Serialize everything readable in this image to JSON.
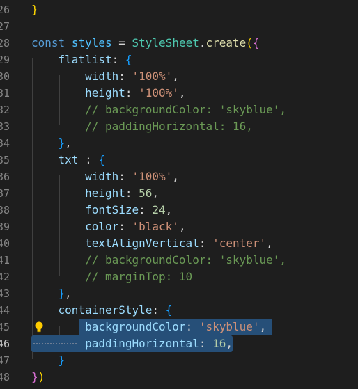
{
  "editor": {
    "line_numbers": [
      "26",
      "27",
      "28",
      "29",
      "30",
      "31",
      "32",
      "33",
      "34",
      "35",
      "36",
      "37",
      "38",
      "39",
      "40",
      "41",
      "42",
      "43",
      "44",
      "45",
      "46",
      "47",
      "48"
    ],
    "active_line": "46",
    "lines": [
      {
        "num": "26",
        "tokens": [
          [
            "b1",
            "}"
          ]
        ]
      },
      {
        "num": "27",
        "tokens": []
      },
      {
        "num": "28",
        "tokens": [
          [
            "kw",
            "const"
          ],
          [
            "p",
            " "
          ],
          [
            "var",
            "styles"
          ],
          [
            "p",
            " = "
          ],
          [
            "cls",
            "StyleSheet"
          ],
          [
            "p",
            "."
          ],
          [
            "fn",
            "create"
          ],
          [
            "b1",
            "("
          ],
          [
            "b2",
            "{"
          ]
        ]
      },
      {
        "num": "29",
        "tokens": [
          [
            "p",
            "    "
          ],
          [
            "prop",
            "flatlist"
          ],
          [
            "p",
            ": "
          ],
          [
            "b3",
            "{"
          ]
        ]
      },
      {
        "num": "30",
        "tokens": [
          [
            "p",
            "        "
          ],
          [
            "prop",
            "width"
          ],
          [
            "p",
            ": "
          ],
          [
            "str",
            "'100%'"
          ],
          [
            "p",
            ","
          ]
        ]
      },
      {
        "num": "31",
        "tokens": [
          [
            "p",
            "        "
          ],
          [
            "prop",
            "height"
          ],
          [
            "p",
            ": "
          ],
          [
            "str",
            "'100%'"
          ],
          [
            "p",
            ","
          ]
        ]
      },
      {
        "num": "32",
        "tokens": [
          [
            "p",
            "        "
          ],
          [
            "com",
            "// backgroundColor: 'skyblue',"
          ]
        ]
      },
      {
        "num": "33",
        "tokens": [
          [
            "p",
            "        "
          ],
          [
            "com",
            "// paddingHorizontal: 16,"
          ]
        ]
      },
      {
        "num": "34",
        "tokens": [
          [
            "p",
            "    "
          ],
          [
            "b3",
            "}"
          ],
          [
            "p",
            ","
          ]
        ]
      },
      {
        "num": "35",
        "tokens": [
          [
            "p",
            "    "
          ],
          [
            "prop",
            "txt"
          ],
          [
            "p",
            " : "
          ],
          [
            "b3",
            "{"
          ]
        ]
      },
      {
        "num": "36",
        "tokens": [
          [
            "p",
            "        "
          ],
          [
            "prop",
            "width"
          ],
          [
            "p",
            ": "
          ],
          [
            "str",
            "'100%'"
          ],
          [
            "p",
            ","
          ]
        ]
      },
      {
        "num": "37",
        "tokens": [
          [
            "p",
            "        "
          ],
          [
            "prop",
            "height"
          ],
          [
            "p",
            ": "
          ],
          [
            "num",
            "56"
          ],
          [
            "p",
            ","
          ]
        ]
      },
      {
        "num": "38",
        "tokens": [
          [
            "p",
            "        "
          ],
          [
            "prop",
            "fontSize"
          ],
          [
            "p",
            ": "
          ],
          [
            "num",
            "24"
          ],
          [
            "p",
            ","
          ]
        ]
      },
      {
        "num": "39",
        "tokens": [
          [
            "p",
            "        "
          ],
          [
            "prop",
            "color"
          ],
          [
            "p",
            ": "
          ],
          [
            "str",
            "'black'"
          ],
          [
            "p",
            ","
          ]
        ]
      },
      {
        "num": "40",
        "tokens": [
          [
            "p",
            "        "
          ],
          [
            "prop",
            "textAlignVertical"
          ],
          [
            "p",
            ": "
          ],
          [
            "str",
            "'center'"
          ],
          [
            "p",
            ","
          ]
        ]
      },
      {
        "num": "41",
        "tokens": [
          [
            "p",
            "        "
          ],
          [
            "com",
            "// backgroundColor: 'skyblue',"
          ]
        ]
      },
      {
        "num": "42",
        "tokens": [
          [
            "p",
            "        "
          ],
          [
            "com",
            "// marginTop: 10"
          ]
        ]
      },
      {
        "num": "43",
        "tokens": [
          [
            "p",
            "    "
          ],
          [
            "b3",
            "}"
          ],
          [
            "p",
            ","
          ]
        ]
      },
      {
        "num": "44",
        "tokens": [
          [
            "p",
            "    "
          ],
          [
            "prop",
            "containerStyle"
          ],
          [
            "p",
            ": "
          ],
          [
            "b3",
            "{"
          ]
        ]
      },
      {
        "num": "45",
        "tokens": [
          [
            "p",
            "        "
          ],
          [
            "prop",
            "backgroundColor"
          ],
          [
            "p",
            ": "
          ],
          [
            "str",
            "'skyblue'"
          ],
          [
            "p",
            ","
          ]
        ]
      },
      {
        "num": "46",
        "tokens": [
          [
            "p",
            "        "
          ],
          [
            "prop",
            "paddingHorizontal"
          ],
          [
            "p",
            ": "
          ],
          [
            "num",
            "16"
          ],
          [
            "p",
            ","
          ]
        ]
      },
      {
        "num": "47",
        "tokens": [
          [
            "p",
            "    "
          ],
          [
            "b3",
            "}"
          ]
        ]
      },
      {
        "num": "48",
        "tokens": [
          [
            "b2",
            "}"
          ],
          [
            "b1",
            ")"
          ]
        ]
      }
    ]
  },
  "lightbulb_icon": "lightbulb-icon",
  "colors": {
    "background": "#1e1e1e",
    "selection": "#264f78",
    "keyword": "#569cd6",
    "property": "#9cdcfe",
    "string": "#ce9178",
    "number": "#b5cea8",
    "comment": "#6a9955"
  }
}
